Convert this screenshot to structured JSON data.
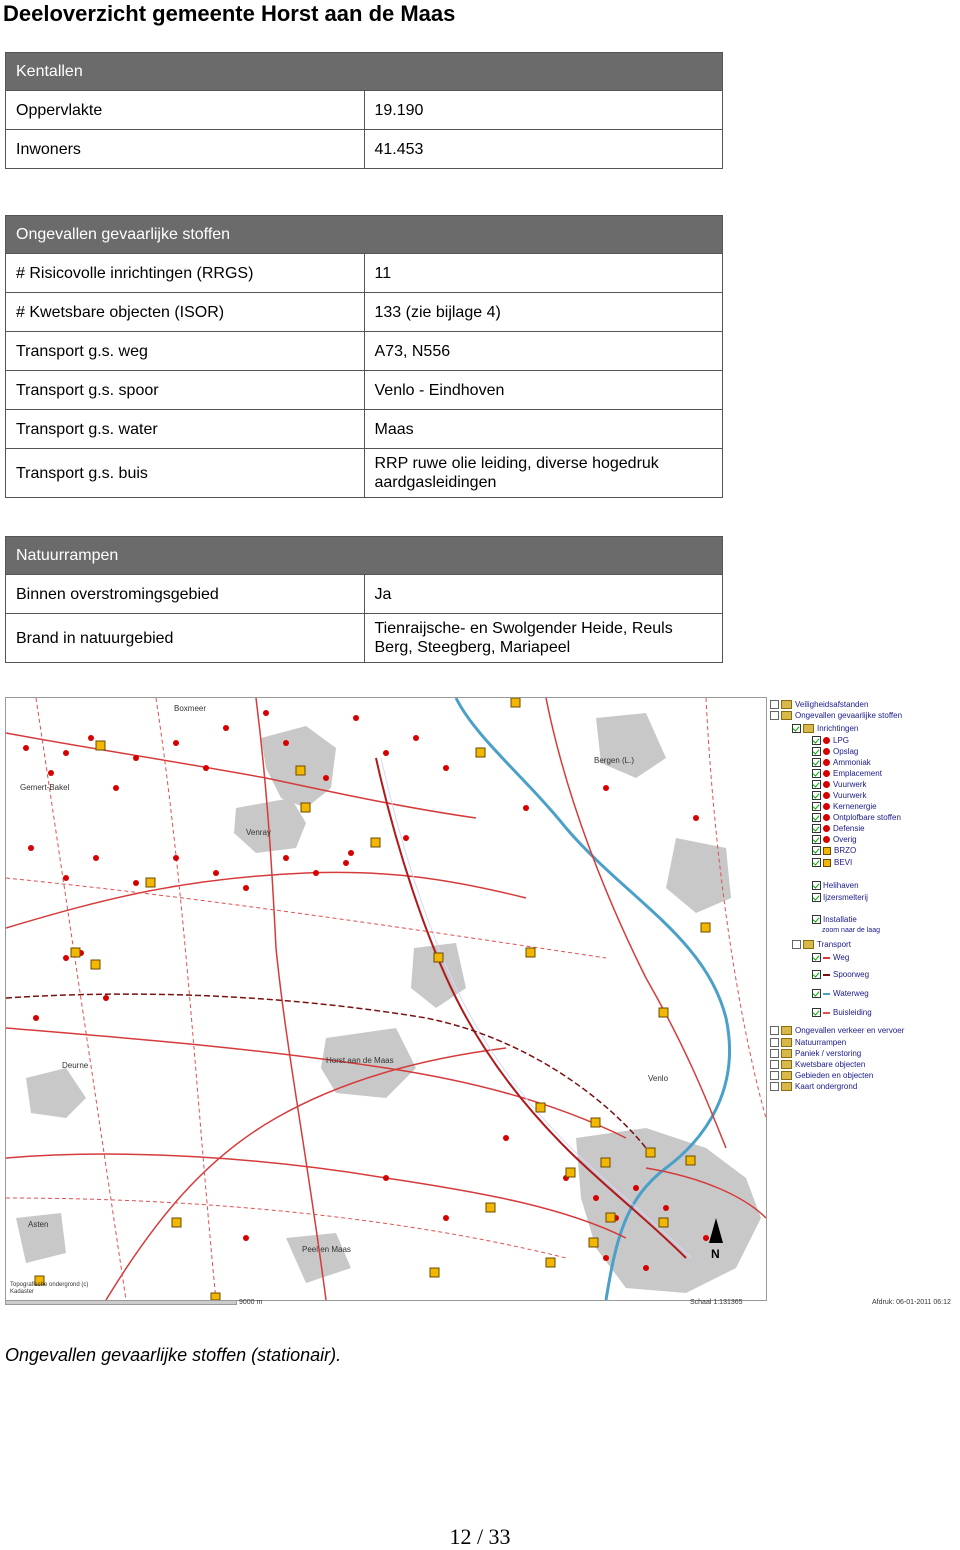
{
  "page_title": "Deeloverzicht gemeente Horst aan de Maas",
  "kentallen": {
    "header": "Kentallen",
    "rows": [
      {
        "label": "Oppervlakte",
        "value": "19.190"
      },
      {
        "label": "Inwoners",
        "value": "41.453"
      }
    ]
  },
  "ongevallen": {
    "header": "Ongevallen gevaarlijke stoffen",
    "rows": [
      {
        "label": "# Risicovolle inrichtingen (RRGS)",
        "value": "11"
      },
      {
        "label": "# Kwetsbare objecten (ISOR)",
        "value": "133 (zie bijlage 4)"
      },
      {
        "label": "Transport g.s. weg",
        "value": "A73, N556"
      },
      {
        "label": "Transport g.s. spoor",
        "value": "Venlo - Eindhoven"
      },
      {
        "label": "Transport g.s. water",
        "value": "Maas"
      },
      {
        "label": "Transport g.s. buis",
        "value": "RRP ruwe olie leiding, diverse hogedruk aardgasleidingen"
      }
    ]
  },
  "natuurrampen": {
    "header": "Natuurrampen",
    "rows": [
      {
        "label": "Binnen overstromingsgebied",
        "value": "Ja"
      },
      {
        "label": "Brand in natuurgebied",
        "value": "Tienraijsche- en Swolgender Heide,  Reuls Berg, Steegberg,  Mariapeel"
      }
    ]
  },
  "map": {
    "place_labels": [
      "Boxmeer",
      "Gemert-Bakel",
      "Venray",
      "Bergen (L.)",
      "Deurne",
      "Horst aan de Maas",
      "Venlo",
      "Asten",
      "Peel en Maas"
    ],
    "credit": "Topografische ondergrond (c) Kadaster",
    "scale_bar": "9000 m",
    "scale_text": "Schaal 1:131365",
    "date_text": "Afdruk: 06-01-2011 06:12",
    "north_label": "N",
    "legend": {
      "groups": [
        {
          "label": "Veiligheidsafstanden"
        },
        {
          "label": "Ongevallen gevaarlijke stoffen"
        },
        {
          "label": "Inrichtingen"
        },
        {
          "label": "LPG"
        },
        {
          "label": "Opslag"
        },
        {
          "label": "Ammoniak"
        },
        {
          "label": "Emplacement"
        },
        {
          "label": "Vuurwerk"
        },
        {
          "label": "Vuurwerk"
        },
        {
          "label": "Kernenergie"
        },
        {
          "label": "Ontplofbare stoffen"
        },
        {
          "label": "Defensie"
        },
        {
          "label": "Overig"
        },
        {
          "label": "BRZO"
        },
        {
          "label": "BEVI"
        },
        {
          "label": "Helihaven"
        },
        {
          "label": "Ijzersmelterij"
        },
        {
          "label": "Installatie"
        },
        {
          "label": "zoom naar de laag"
        },
        {
          "label": "Transport"
        },
        {
          "label": "Weg"
        },
        {
          "label": "Spoorweg"
        },
        {
          "label": "Waterweg"
        },
        {
          "label": "Buisleiding"
        },
        {
          "label": "Ongevallen verkeer en vervoer"
        },
        {
          "label": "Natuurrampen"
        },
        {
          "label": "Paniek / verstoring"
        },
        {
          "label": "Kwetsbare objecten"
        },
        {
          "label": "Gebieden en objecten"
        },
        {
          "label": "Kaart ondergrond"
        }
      ]
    }
  },
  "caption": "Ongevallen gevaarlijke stoffen (stationair).",
  "page_number": "12 / 33",
  "colors": {
    "table_header": "#6b6b6b",
    "road": "#d63b3b",
    "railway": "#b01a1a",
    "river": "#4aa0c8",
    "urban": "#c4c4c4",
    "marker_red": "#d60000",
    "marker_box": "#f2b700"
  }
}
